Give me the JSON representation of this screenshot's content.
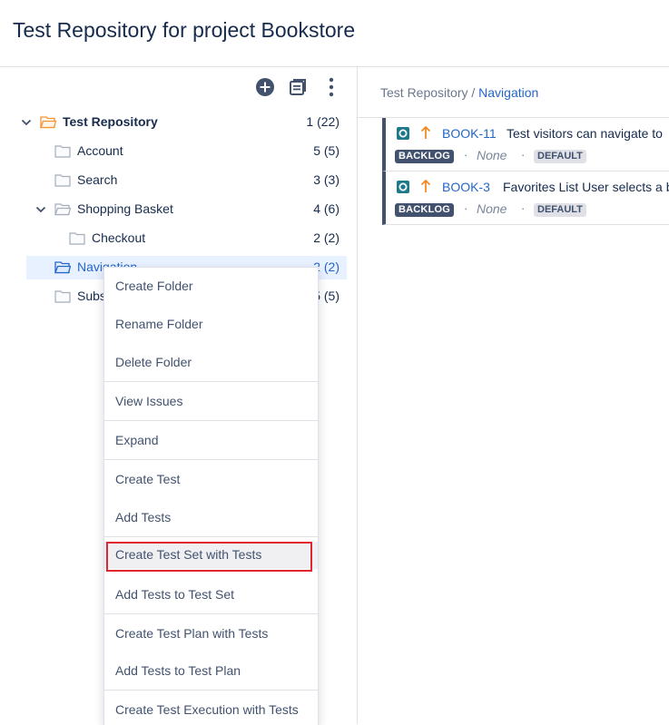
{
  "page": {
    "title": "Test Repository for project Bookstore"
  },
  "toolbar": {
    "add_icon": "plus-circle-icon",
    "view_icon": "document-list-icon",
    "more_icon": "vertical-ellipsis-icon"
  },
  "tree": {
    "items": [
      {
        "label": "Test Repository",
        "count": "1 (22)",
        "expanded": true
      },
      {
        "label": "Account",
        "count": "5 (5)"
      },
      {
        "label": "Search",
        "count": "3 (3)"
      },
      {
        "label": "Shopping Basket",
        "count": "4 (6)",
        "expanded": true
      },
      {
        "label": "Checkout",
        "count": "2 (2)"
      },
      {
        "label": "Navigation",
        "count": "2 (2)",
        "selected": true
      },
      {
        "label": "Subs",
        "count": "5 (5)"
      }
    ]
  },
  "breadcrumb": {
    "root": "Test Repository",
    "separator": " / ",
    "current": "Navigation"
  },
  "issues": [
    {
      "key": "BOOK-11",
      "summary": "Test visitors can navigate to",
      "status": "BACKLOG",
      "none": "None",
      "label": "DEFAULT"
    },
    {
      "key": "BOOK-3",
      "summary": "Favorites List User selects a b",
      "status": "BACKLOG",
      "none": "None",
      "label": "DEFAULT"
    }
  ],
  "context_menu": {
    "items": [
      "Create Folder",
      "Rename Folder",
      "Delete Folder",
      "View Issues",
      "Expand",
      "Create Test",
      "Add Tests",
      "Create Test Set with Tests",
      "Add Tests to Test Set",
      "Create Test Plan with Tests",
      "Add Tests to Test Plan",
      "Create Test Execution with Tests"
    ],
    "highlighted": "Create Test Set with Tests"
  },
  "colors": {
    "link": "#2566c9",
    "text": "#172b4d",
    "folder_open": "#f79232",
    "priority_high": "#f08a24",
    "test_icon": "#1d7a8c",
    "highlight_outline": "#e0262e",
    "status_badge": "#42526e"
  }
}
